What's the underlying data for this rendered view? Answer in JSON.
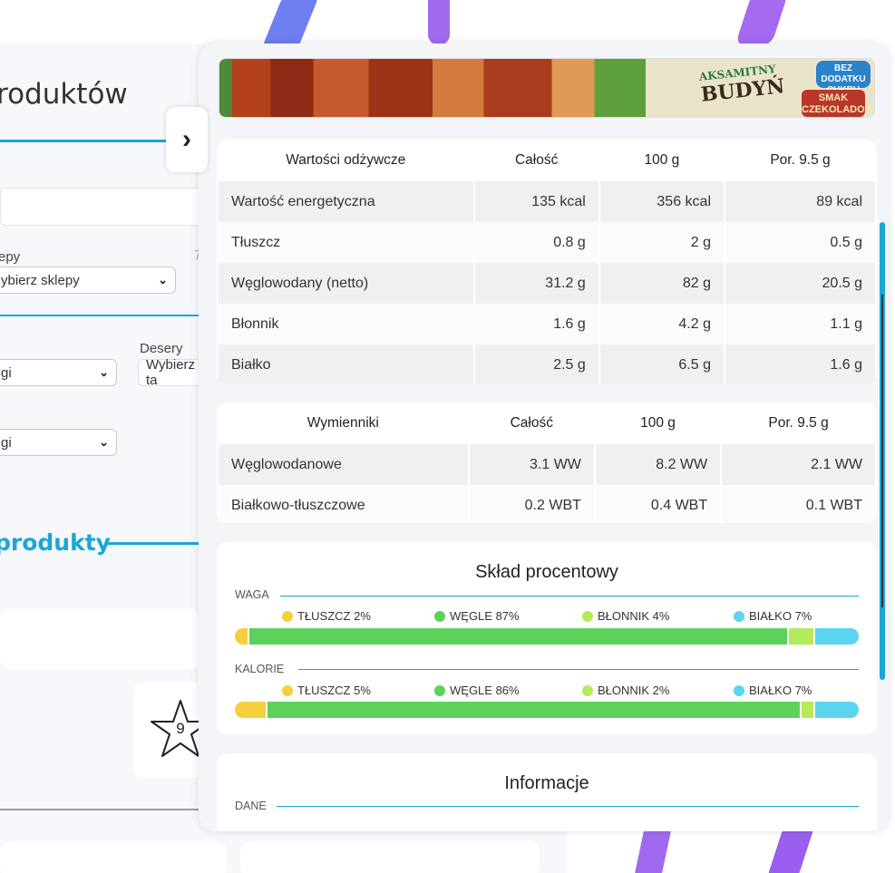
{
  "page": {
    "heading": "roduktów",
    "shops_label": "epy",
    "shops_select": "ybierz sklepy",
    "shops_hint": "7",
    "desserts_label": "Desery",
    "desserts_select": "Wybierz ta",
    "select_a": "gi",
    "select_b": "gi",
    "section_heading": "produkty",
    "rating": "9"
  },
  "panel": {
    "banner": {
      "product_name": "BUDYŃ",
      "product_adj": "AKSAMITNY",
      "badge_1": "BEZ DODATKU CUKRU",
      "badge_2": "SMAK CZEKOLADOWY"
    },
    "nutrition": {
      "headers": [
        "Wartości odżywcze",
        "Całość",
        "100 g",
        "Por. 9.5 g"
      ],
      "rows": [
        [
          "Wartość energetyczna",
          "135 kcal",
          "356 kcal",
          "89 kcal"
        ],
        [
          "Tłuszcz",
          "0.8 g",
          "2 g",
          "0.5 g"
        ],
        [
          "Węglowodany (netto)",
          "31.2 g",
          "82 g",
          "20.5 g"
        ],
        [
          "Błonnik",
          "1.6 g",
          "4.2 g",
          "1.1 g"
        ],
        [
          "Białko",
          "2.5 g",
          "6.5 g",
          "1.6 g"
        ]
      ]
    },
    "exchangers": {
      "headers": [
        "Wymienniki",
        "Całość",
        "100 g",
        "Por. 9.5 g"
      ],
      "rows": [
        [
          "Węglowodanowe",
          "3.1 WW",
          "8.2 WW",
          "2.1 WW"
        ],
        [
          "Białkowo-tłuszczowe",
          "0.2 WBT",
          "0.4 WBT",
          "0.1 WBT"
        ]
      ]
    },
    "composition": {
      "title": "Skład procentowy",
      "colors": {
        "fat": "#f5cf3c",
        "carbs": "#5cd25a",
        "fiber": "#b5ea5a",
        "protein": "#5ad4ef"
      },
      "weight": {
        "label": "WAGA",
        "items": [
          {
            "label": "TŁUSZCZ 2%",
            "key": "fat",
            "pct": 2
          },
          {
            "label": "WĘGLE 87%",
            "key": "carbs",
            "pct": 87
          },
          {
            "label": "BŁONNIK 4%",
            "key": "fiber",
            "pct": 4
          },
          {
            "label": "BIAŁKO 7%",
            "key": "protein",
            "pct": 7
          }
        ]
      },
      "calories": {
        "label": "KALORIE",
        "items": [
          {
            "label": "TŁUSZCZ 5%",
            "key": "fat",
            "pct": 5
          },
          {
            "label": "WĘGLE 86%",
            "key": "carbs",
            "pct": 86
          },
          {
            "label": "BŁONNIK 2%",
            "key": "fiber",
            "pct": 2
          },
          {
            "label": "BIAŁKO 7%",
            "key": "protein",
            "pct": 7
          }
        ]
      }
    },
    "info": {
      "title": "Informacje",
      "data_label": "DANE"
    }
  }
}
